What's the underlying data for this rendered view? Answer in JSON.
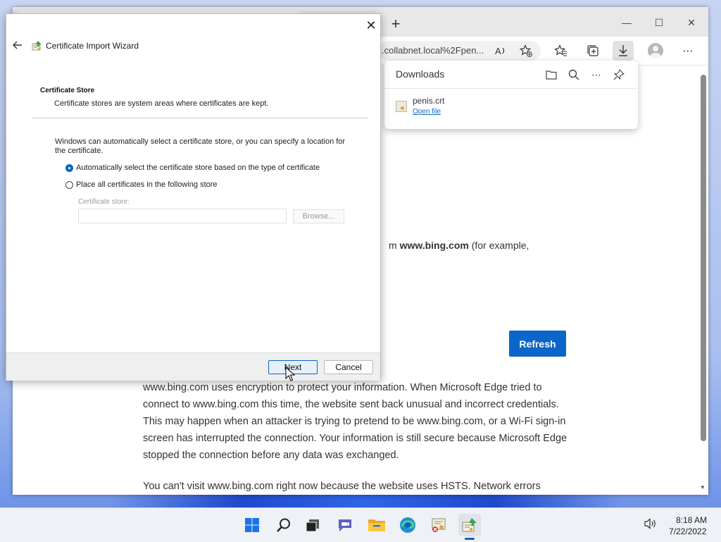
{
  "browser": {
    "url_text": ".collabnet.local%2Fpen...",
    "toolbar_icons": [
      "read-aloud-icon",
      "add-favorite-icon",
      "favorites-icon",
      "collections-icon",
      "downloads-icon",
      "profile-icon",
      "more-icon"
    ],
    "page": {
      "snippet_prefix": "m ",
      "snippet_bold": "www.bing.com",
      "snippet_suffix": " (for example,",
      "refresh_label": "Refresh",
      "paragraph1": "www.bing.com uses encryption to protect your information. When Microsoft Edge tried to connect to www.bing.com this time, the website sent back unusual and incorrect credentials. This may happen when an attacker is trying to pretend to be www.bing.com, or a Wi-Fi sign-in screen has interrupted the connection. Your information is still secure because Microsoft Edge stopped the connection before any data was exchanged.",
      "paragraph2": "You can't visit www.bing.com right now because the website uses HSTS. Network errors"
    }
  },
  "downloads": {
    "title": "Downloads",
    "item": {
      "filename": "penis.crt",
      "action": "Open file"
    }
  },
  "wizard": {
    "title": "Certificate Import Wizard",
    "heading": "Certificate Store",
    "subheading": "Certificate stores are system areas where certificates are kept.",
    "description": "Windows can automatically select a certificate store, or you can specify a location for the certificate.",
    "option_auto": "Automatically select the certificate store based on the type of certificate",
    "option_manual": "Place all certificates in the following store",
    "store_label": "Certificate store:",
    "store_value": "",
    "browse_label": "Browse...",
    "next_label": "Next",
    "cancel_label": "Cancel",
    "selected_option": "auto"
  },
  "taskbar": {
    "apps": [
      "start-icon",
      "search-icon",
      "task-view-icon",
      "chat-icon",
      "file-explorer-icon",
      "edge-icon",
      "certificate-error-icon",
      "certificate-wizard-icon"
    ],
    "time": "8:18 AM",
    "date": "7/22/2022"
  },
  "colors": {
    "accent": "#0a66c8"
  }
}
